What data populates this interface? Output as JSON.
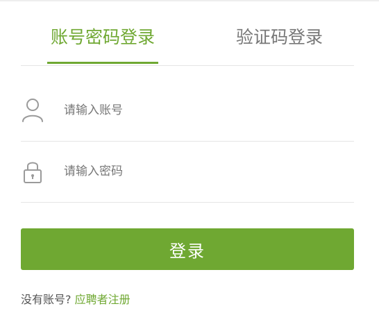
{
  "tabs": [
    {
      "label": "账号密码登录",
      "active": true
    },
    {
      "label": "验证码登录",
      "active": false
    }
  ],
  "form": {
    "account_placeholder": "请输入账号",
    "account_value": "",
    "password_placeholder": "请输入密码",
    "password_value": "",
    "account_icon": "user-icon",
    "password_icon": "lock-icon"
  },
  "login_button_label": "登录",
  "register": {
    "prompt": "没有账号?",
    "link_label": "应聘者注册"
  },
  "colors": {
    "accent": "#6fa832",
    "inactive_text": "#777777",
    "divider": "#e5e5e5"
  }
}
